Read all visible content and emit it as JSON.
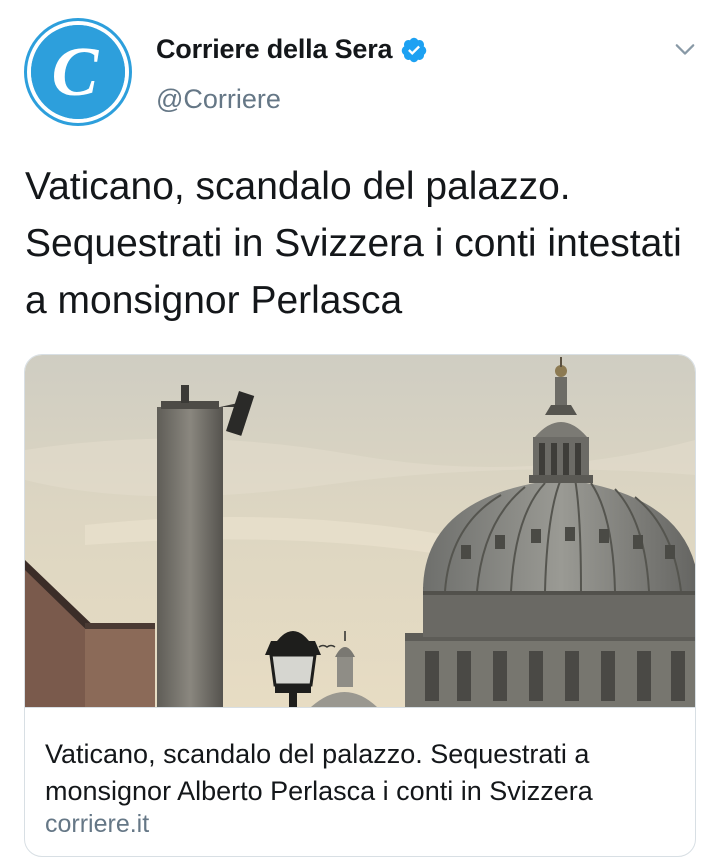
{
  "author": {
    "display_name": "Corriere della Sera",
    "handle": "@Corriere",
    "verified": true,
    "avatar_letter": "C",
    "avatar_color": "#2d9fdc",
    "verified_color": "#1da1f2"
  },
  "tweet": {
    "text": "Vaticano, scandalo del palazzo. Sequestrati in Svizzera i conti intestati a monsignor Perlasca"
  },
  "card": {
    "title": "Vaticano, scandalo del palazzo. Sequestrati a monsignor Alberto Perlasca i conti in Svizzera",
    "domain": "corriere.it"
  },
  "icons": {
    "menu": "chevron-down-icon",
    "verified": "verified-badge-icon"
  }
}
